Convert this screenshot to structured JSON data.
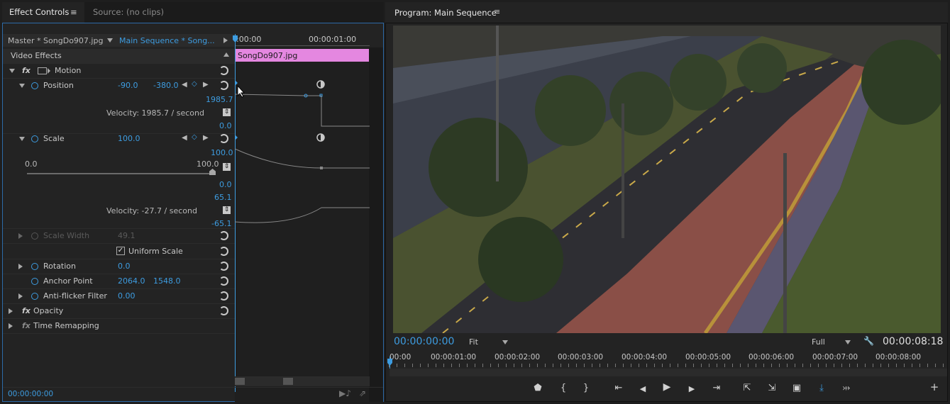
{
  "effect_controls": {
    "tab_label": "Effect Controls",
    "source_tab_label": "Source: (no clips)",
    "master_label": "Master * SongDo907.jpg",
    "sequence_label": "Main Sequence * Song...",
    "ruler_start": ":00:00",
    "ruler_mid": "00:00:01:00",
    "clip_name": "SongDo907.jpg",
    "video_effects": "Video Effects",
    "fx_symbol": "fx",
    "motion": "Motion",
    "position": {
      "label": "Position",
      "x": "-90.0",
      "y": "-380.0"
    },
    "pos_graph_max": "1985.7",
    "pos_velocity": "Velocity: 1985.7 / second",
    "pos_graph_min": "0.0",
    "scale": {
      "label": "Scale",
      "value": "100.0"
    },
    "scale_graph_max": "100.0",
    "scale_slider_min": "0.0",
    "scale_slider_max": "100.0",
    "scale_graph_min": "0.0",
    "scale_vel_max": "65.1",
    "scale_velocity": "Velocity: -27.7 / second",
    "scale_vel_min": "-65.1",
    "scale_width": {
      "label": "Scale Width",
      "value": "49.1"
    },
    "uniform_scale": "Uniform Scale",
    "check_mark": "✓",
    "rotation": {
      "label": "Rotation",
      "value": "0.0"
    },
    "anchor_point": {
      "label": "Anchor Point",
      "x": "2064.0",
      "y": "1548.0"
    },
    "anti_flicker": {
      "label": "Anti-flicker Filter",
      "value": "0.00"
    },
    "opacity": "Opacity",
    "time_remapping": "Time Remapping",
    "timecode": "00:00:00:00"
  },
  "program": {
    "title": "Program: Main Sequence",
    "timecode": "00:00:00:00",
    "fit": "Fit",
    "full": "Full",
    "duration": "00:00:08:18",
    "ruler": [
      "00:00",
      "00:00:01:00",
      "00:00:02:00",
      "00:00:03:00",
      "00:00:04:00",
      "00:00:05:00",
      "00:00:06:00",
      "00:00:07:00",
      "00:00:08:00"
    ],
    "controls": {
      "marker": "⬟",
      "mark_in": "{",
      "mark_out": "}",
      "go_in": "⇤",
      "step_back": "◀",
      "play": "▶",
      "step_fwd": "▶",
      "go_out": "⇥",
      "lift": "⇱",
      "extract": "⇲",
      "export_frame": "▣",
      "button_editor": "+",
      "insert": "⤓",
      "overwrite": "⤔"
    }
  },
  "colors": {
    "accent": "#3d9ce0",
    "clip": "#e487e0",
    "panel": "#232323"
  }
}
